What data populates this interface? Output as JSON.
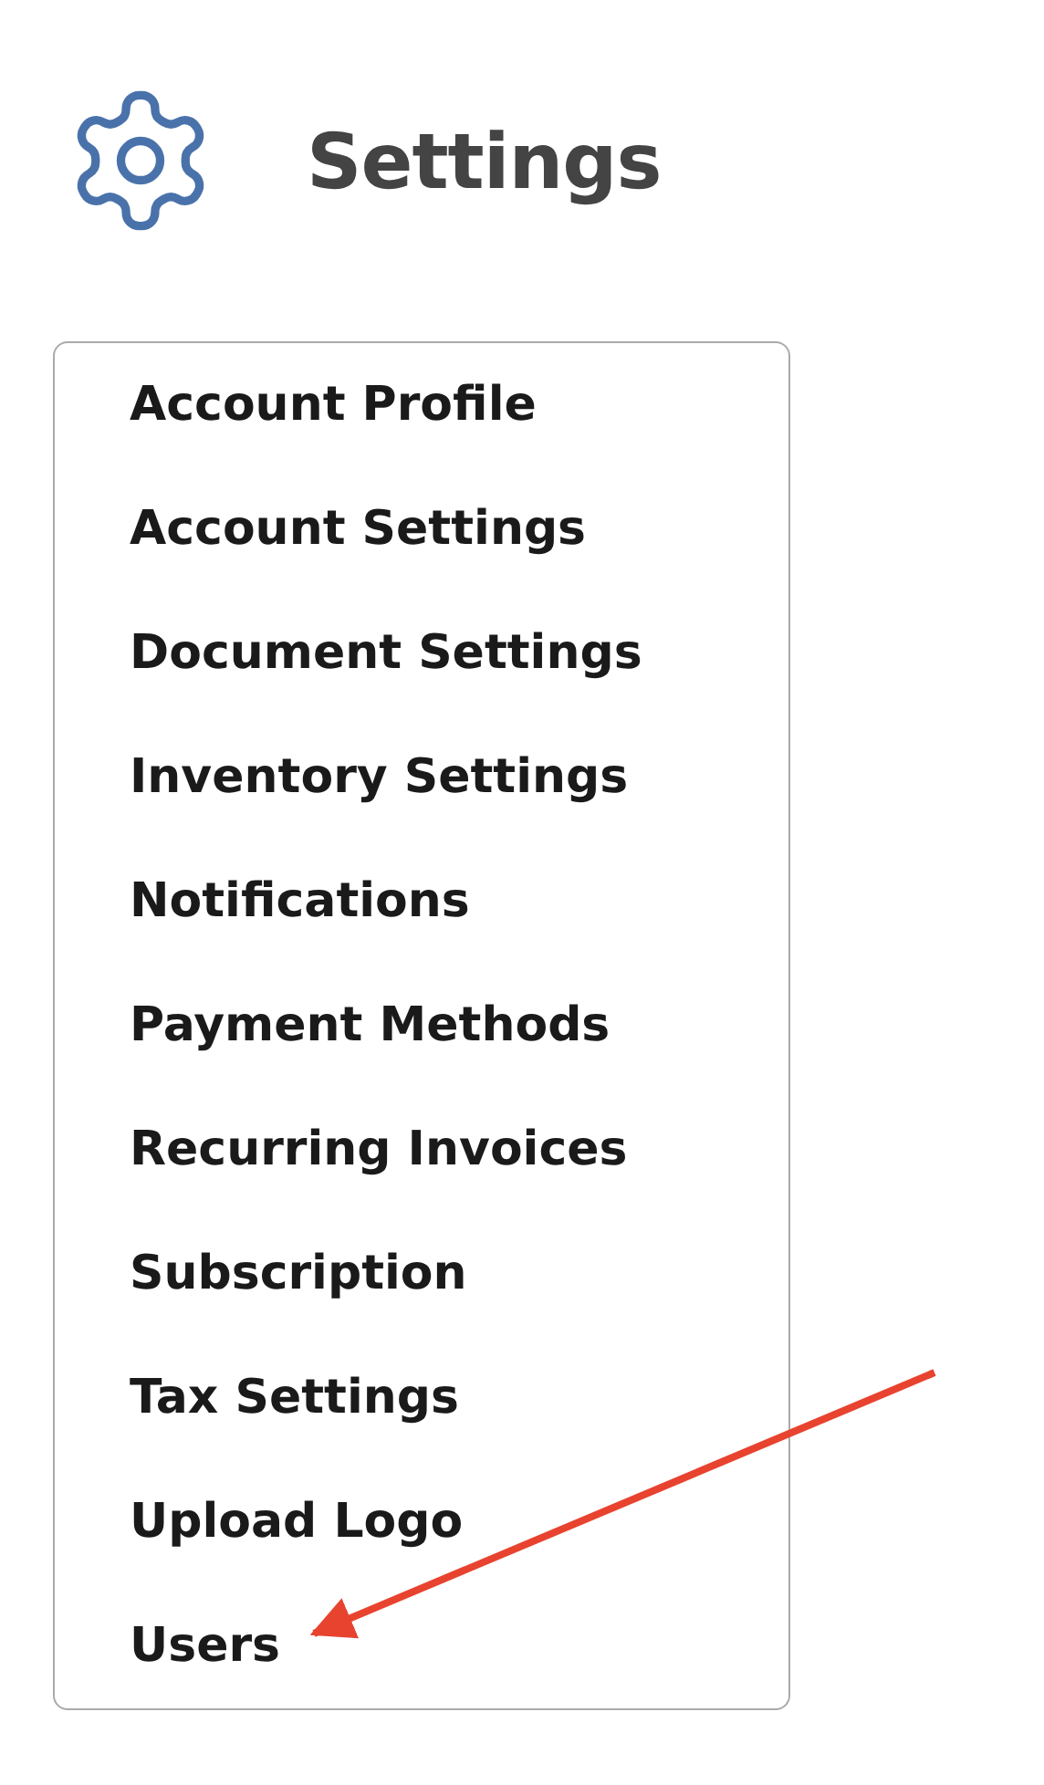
{
  "header": {
    "title": "Settings"
  },
  "menu": {
    "items": [
      {
        "label": "Account Profile"
      },
      {
        "label": "Account Settings"
      },
      {
        "label": "Document Settings"
      },
      {
        "label": "Inventory Settings"
      },
      {
        "label": "Notifications"
      },
      {
        "label": "Payment Methods"
      },
      {
        "label": "Recurring Invoices"
      },
      {
        "label": "Subscription"
      },
      {
        "label": "Tax Settings"
      },
      {
        "label": "Upload Logo"
      },
      {
        "label": "Users"
      }
    ]
  }
}
